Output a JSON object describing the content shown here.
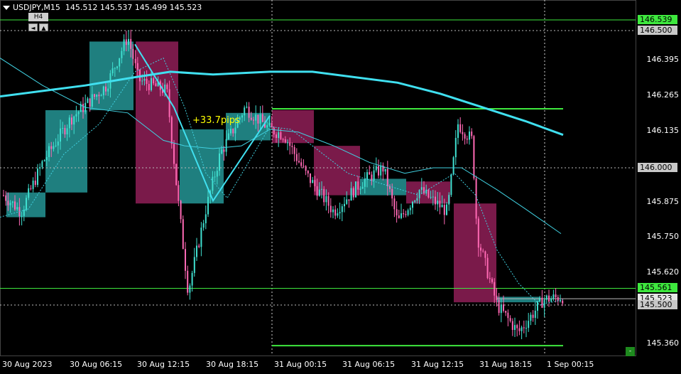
{
  "header": {
    "symbol_tf": "USDJPY,M15",
    "ohlc": "145.512 145.537 145.499 145.523"
  },
  "timeframe_box": "H4",
  "nav_buttons": [
    "◄",
    "▲"
  ],
  "annotation": "+33.7pips",
  "corner_button": "-",
  "price_axis": [
    "146.395",
    "146.265",
    "146.135",
    "145.875",
    "145.750",
    "145.620",
    "145.360"
  ],
  "price_tags": [
    {
      "label": "146.539",
      "price": 146.539,
      "bg": "#3ee83e",
      "fg": "#000000"
    },
    {
      "label": "146.500",
      "price": 146.5,
      "bg": "#c8c8c8",
      "fg": "#000000"
    },
    {
      "label": "146.000",
      "price": 146.0,
      "bg": "#c8c8c8",
      "fg": "#000000"
    },
    {
      "label": "145.561",
      "price": 145.561,
      "bg": "#3ee83e",
      "fg": "#000000"
    },
    {
      "label": "145.523",
      "price": 145.523,
      "bg": "#e6e6e6",
      "fg": "#000000"
    },
    {
      "label": "145.500",
      "price": 145.5,
      "bg": "#c8c8c8",
      "fg": "#000000"
    }
  ],
  "time_axis": [
    "30 Aug 2023",
    "30 Aug 06:15",
    "30 Aug 12:15",
    "30 Aug 18:15",
    "31 Aug 00:15",
    "31 Aug 06:15",
    "31 Aug 12:15",
    "31 Aug 18:15",
    "1 Sep 00:15"
  ],
  "colors": {
    "background": "#000000",
    "bull_candle": "#40e0d0",
    "bear_candle": "#ff69b4",
    "bull_box": "#1f7f7f",
    "bear_box": "#7a1a4a",
    "ma_slow": "#40e0f0",
    "ma_mid": "#40d0e0",
    "level_line": "#3ee83e",
    "annotation": "#ffff00"
  },
  "chart_data": {
    "type": "candlestick",
    "ylim": [
      145.3,
      146.6
    ],
    "h4_boxes": [
      {
        "dir": "bull",
        "open": 145.91,
        "close": 145.82
      },
      {
        "dir": "bull",
        "open": 145.91,
        "close": 146.21
      },
      {
        "dir": "bull",
        "open": 146.21,
        "close": 146.46
      },
      {
        "dir": "bear",
        "open": 146.46,
        "close": 145.87
      },
      {
        "dir": "bull",
        "open": 145.87,
        "close": 146.14
      },
      {
        "dir": "bull",
        "open": 146.1,
        "close": 146.2
      },
      {
        "dir": "bear",
        "open": 146.21,
        "close": 146.09
      },
      {
        "dir": "bear",
        "open": 146.08,
        "close": 145.9
      },
      {
        "dir": "bull",
        "open": 145.9,
        "close": 145.96
      },
      {
        "dir": "bear",
        "open": 145.95,
        "close": 145.87
      },
      {
        "dir": "bear",
        "open": 145.87,
        "close": 145.51
      },
      {
        "dir": "bull",
        "open": 145.51,
        "close": 145.53
      }
    ],
    "levels": [
      146.539,
      146.215,
      145.561,
      145.352
    ]
  }
}
